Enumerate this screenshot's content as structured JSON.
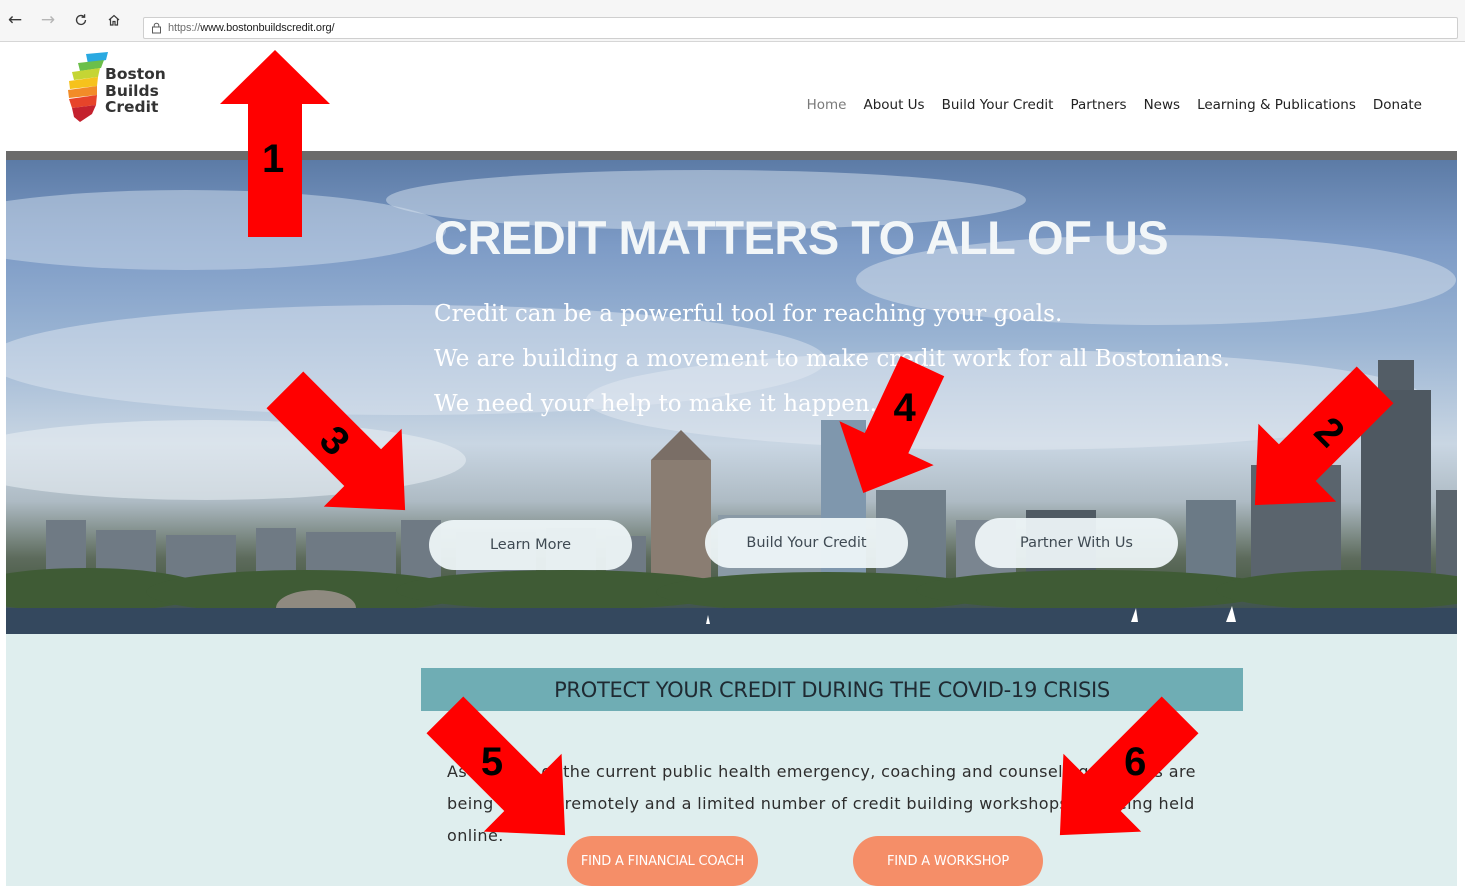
{
  "browser": {
    "url_prefix": "https://",
    "url_host": "www.bostonbuildscredit.org/",
    "icons": [
      "back-icon",
      "forward-icon",
      "refresh-icon",
      "home-icon",
      "lock-icon"
    ]
  },
  "logo": {
    "line1": "Boston",
    "line2": "Builds",
    "line3": "Credit"
  },
  "nav": {
    "home": "Home",
    "about": "About Us",
    "build": "Build Your Credit",
    "partners": "Partners",
    "news": "News",
    "learning": "Learning & Publications",
    "donate": "Donate"
  },
  "hero": {
    "title": "CREDIT MATTERS TO ALL OF US",
    "line1": "Credit can be a powerful tool for reaching your goals.",
    "line2": "We are building a movement to make credit work for all Bostonians.",
    "line3": "We need your help to make it happen.",
    "btn_learn": "Learn More",
    "btn_build": "Build Your Credit",
    "btn_partner": "Partner With Us"
  },
  "covid": {
    "banner": "PROTECT YOUR CREDIT DURING THE COVID-19 CRISIS",
    "line1": "As a result of the current public health emergency, coaching and counseling services are",
    "line2": "being offered remotely and a limited number of credit building workshops are being held online.",
    "btn_coach": "FIND A FINANCIAL COACH",
    "btn_workshop": "FIND A WORKSHOP"
  },
  "annotations": {
    "color": "#ff0000",
    "labels": [
      "1",
      "2",
      "3",
      "4",
      "5",
      "6"
    ]
  }
}
